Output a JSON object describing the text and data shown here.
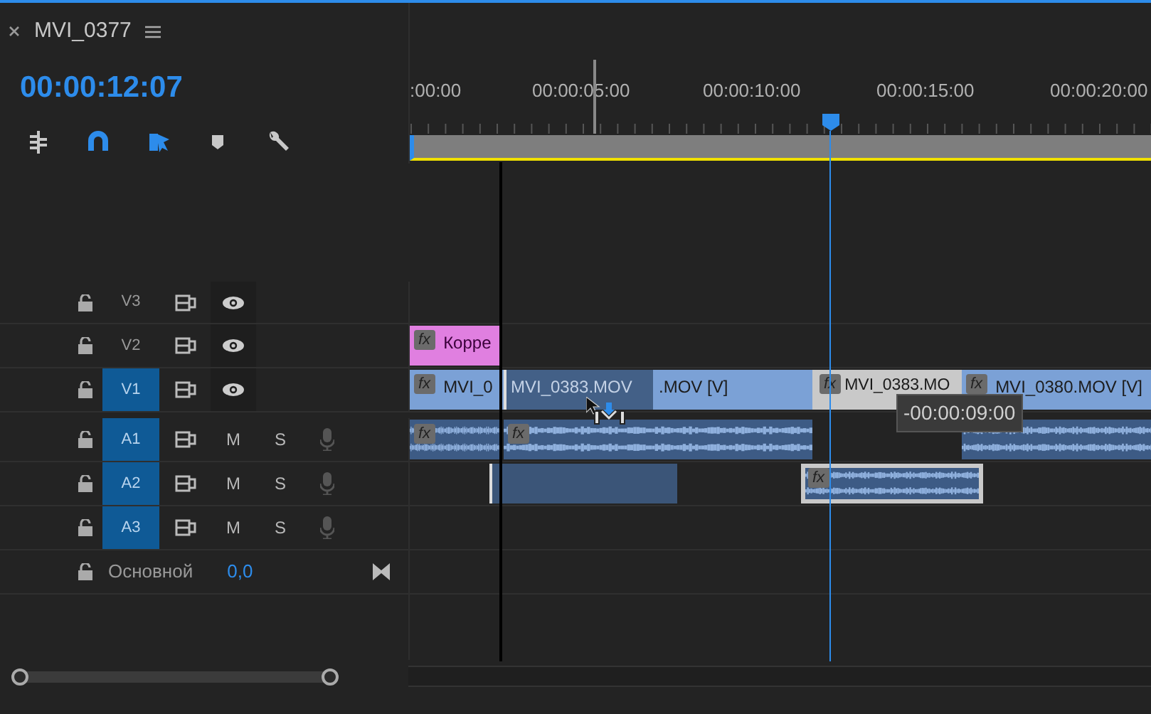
{
  "sequence": {
    "title": "MVI_0377"
  },
  "timecode": "00:00:12:07",
  "tools": [
    {
      "kind": "insert",
      "selected": false
    },
    {
      "kind": "snap",
      "selected": true
    },
    {
      "kind": "linked",
      "selected": true
    },
    {
      "kind": "marker",
      "selected": false
    },
    {
      "kind": "wrench",
      "selected": false
    }
  ],
  "ruler": {
    "labels": [
      ":00:00",
      "00:00:05:00",
      "00:00:10:00",
      "00:00:15:00",
      "00:00:20:00"
    ]
  },
  "tracks": [
    {
      "kind": "video",
      "name": "V3",
      "targeted": false
    },
    {
      "kind": "video",
      "name": "V2",
      "targeted": false,
      "clips": [
        {
          "kind": "adjustment",
          "label": "Корре",
          "badge": "fx"
        }
      ]
    },
    {
      "kind": "video",
      "name": "V1",
      "targeted": true,
      "clips": [
        {
          "kind": "video",
          "label": "MVI_0",
          "badge": "fx"
        },
        {
          "kind": "ghost",
          "label": "MVI_0383.MOV"
        },
        {
          "kind": "video",
          "label": ".MOV [V]"
        },
        {
          "kind": "selected",
          "label": "MVI_0383.MO",
          "badge": "fx"
        },
        {
          "kind": "video",
          "label": "MVI_0380.MOV [V]",
          "badge": "fx"
        }
      ]
    },
    {
      "kind": "audio",
      "name": "A1",
      "targeted": true,
      "mute": "M",
      "solo": "S",
      "clips": [
        {
          "kind": "audio",
          "badge": "fx"
        },
        {
          "kind": "audio",
          "badge": "fx"
        },
        {
          "kind": "audio"
        }
      ]
    },
    {
      "kind": "audio",
      "name": "A2",
      "targeted": true,
      "mute": "M",
      "solo": "S",
      "clips": [
        {
          "kind": "ghost"
        },
        {
          "kind": "selected",
          "badge": "fx"
        }
      ]
    },
    {
      "kind": "audio",
      "name": "A3",
      "targeted": true,
      "mute": "M",
      "solo": "S"
    }
  ],
  "master": {
    "name": "Основной",
    "value": "0,0"
  },
  "tooltip": "-00:00:09:00"
}
